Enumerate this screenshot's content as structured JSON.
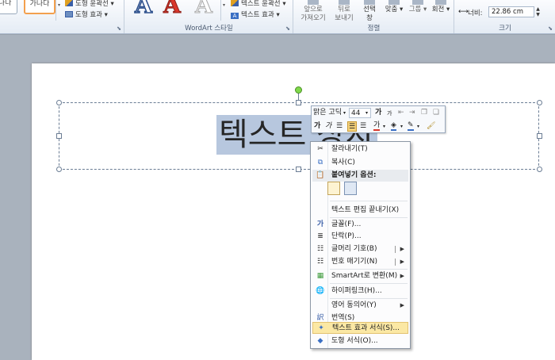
{
  "ribbon": {
    "shape_samples": [
      "가나다",
      "가나다"
    ],
    "shape_styles": {
      "outline_label": "도형 윤곽선",
      "effects_label": "도형 효과"
    },
    "wordart": {
      "sample_letter": "A",
      "text_outline_label": "텍스트 윤곽선",
      "text_effects_label": "텍스트 효과",
      "group_label": "WordArt 스타일"
    },
    "arrange": {
      "bring_forward": [
        "앞으로",
        "가져오기"
      ],
      "send_backward": [
        "뒤로",
        "보내기"
      ],
      "selection_pane": [
        "선택",
        "창"
      ],
      "align": "맞춤",
      "group": "그룹",
      "rotate": "회전",
      "group_label": "정렬"
    },
    "size": {
      "width_label": "너비:",
      "width_value": "22.86 cm",
      "group_label": "크기"
    }
  },
  "slide": {
    "selected_text": "텍스트 상자"
  },
  "mini_toolbar": {
    "font_name": "맑은 고딕",
    "font_size": "44",
    "grow_font": "가",
    "shrink_font": "가",
    "bold": "가",
    "italic": "가",
    "font_color_letter": "가"
  },
  "context_menu": {
    "cut": "잘라내기(T)",
    "copy": "복사(C)",
    "paste_options": "붙여넣기 옵션:",
    "exit_edit": "텍스트 편집 끝내기(X)",
    "font": "글꼴(F)...",
    "paragraph": "단락(P)...",
    "bullets": "글머리 기호(B)",
    "numbering": "번호 매기기(N)",
    "smartart": "SmartArt로 변환(M)",
    "hyperlink": "하이퍼링크(H)...",
    "synonyms": "영어 동의어(Y)",
    "translate": "번역(S)",
    "format_text_effects": "텍스트 효과 서식(S)...",
    "format_shape": "도형 서식(O)..."
  },
  "colors": {
    "menu_hover": "#fbe8a4",
    "selection": "#b7c7de",
    "accent_orange": "#f3a04e",
    "wordart_red": "#d9372b"
  }
}
